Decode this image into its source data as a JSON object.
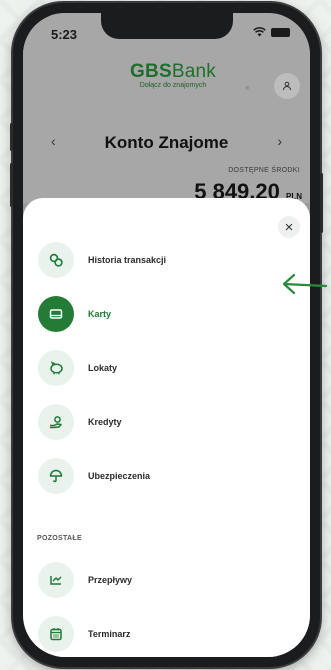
{
  "status": {
    "time": "5:23"
  },
  "header": {
    "logo_main": "GBS",
    "logo_bank": "Bank",
    "logo_tagline": "Dołącz do znajomych",
    "account_title": "Konto Znajome",
    "prev_icon": "‹",
    "next_icon": "›",
    "available_label": "DOSTĘPNE ŚRODKI",
    "balance": "5 849,20",
    "currency": "PLN"
  },
  "sheet": {
    "close_icon": "×",
    "items": [
      {
        "label": "Historia transakcji",
        "icon": "coins-icon",
        "active": false
      },
      {
        "label": "Karty",
        "icon": "card-icon",
        "active": true
      },
      {
        "label": "Lokaty",
        "icon": "piggy-bank-icon",
        "active": false
      },
      {
        "label": "Kredyty",
        "icon": "money-hand-icon",
        "active": false
      },
      {
        "label": "Ubezpieczenia",
        "icon": "umbrella-icon",
        "active": false
      }
    ],
    "section_other": "POZOSTAŁE",
    "other_items": [
      {
        "label": "Przepływy",
        "icon": "flows-icon"
      },
      {
        "label": "Terminarz",
        "icon": "calendar-icon"
      }
    ]
  },
  "colors": {
    "brand_green": "#237b36",
    "icon_bg": "#e9f2ec"
  }
}
